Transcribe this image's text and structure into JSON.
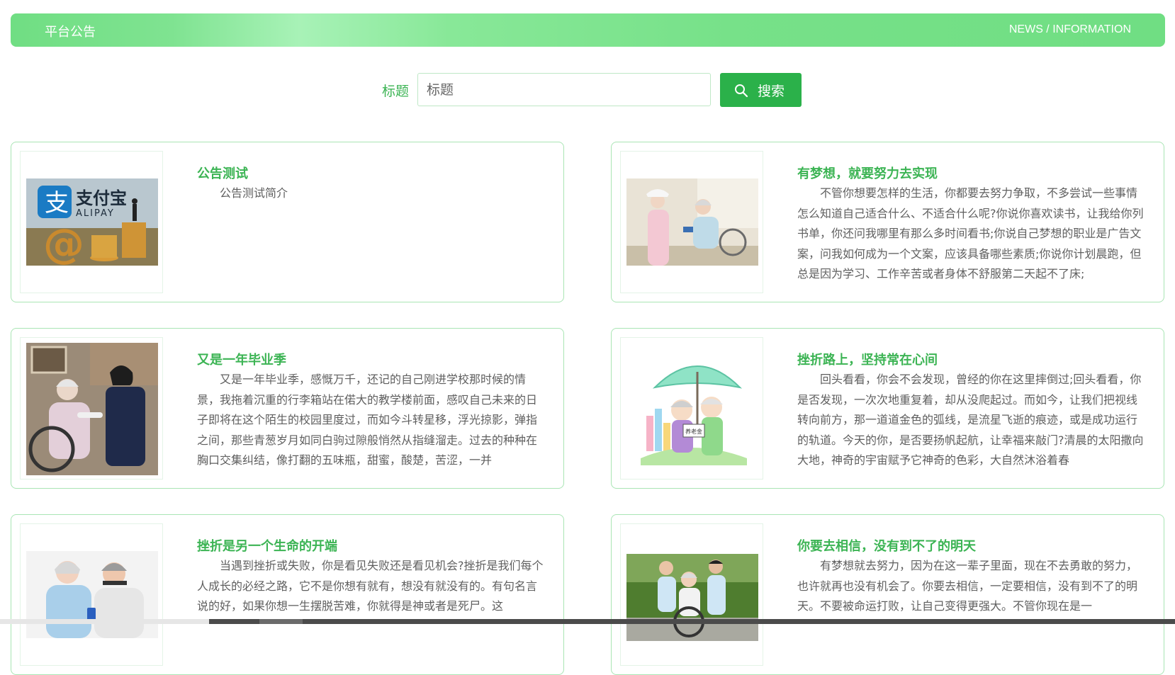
{
  "header": {
    "title": "平台公告",
    "subtitle": "NEWS / INFORMATION"
  },
  "search": {
    "label": "标题",
    "placeholder": "标题",
    "button_label": "搜索"
  },
  "colors": {
    "accent": "#2bb14a",
    "title_green": "#3cb454",
    "border_green": "#a9e5b4"
  },
  "cards": [
    {
      "title": "公告测试",
      "summary": "公告测试简介",
      "image": "alipay-logo-with-coins"
    },
    {
      "title": "有梦想，就要努力去实现",
      "summary": "不管你想要怎样的生活，你都要去努力争取，不多尝试一些事情怎么知道自己适合什么、不适合什么呢?你说你喜欢读书，让我给你列书单，你还问我哪里有那么多时间看书;你说自己梦想的职业是广告文案，问我如何成为一个文案，应该具备哪些素质;你说你计划晨跑，但总是因为学习、工作辛苦或者身体不舒服第二天起不了床;",
      "image": "nurse-with-elderly-woman"
    },
    {
      "title": "又是一年毕业季",
      "summary": "又是一年毕业季，感慨万千，还记的自己刚进学校那时候的情景，我拖着沉重的行李箱站在偌大的教学楼前面，感叹自己未来的日子即将在这个陌生的校园里度过，而如今斗转星移，浮光掠影，弹指之间，那些青葱岁月如同白驹过隙般悄然从指缝溜走。过去的种种在胸口交集纠结，像打翻的五味瓶，甜蜜，酸楚，苦涩，一并",
      "image": "caregiver-feeding-elderly-woman"
    },
    {
      "title": "挫折路上，坚持常在心间",
      "summary": "回头看看，你会不会发现，曾经的你在这里摔倒过;回头看看，你是否发现，一次次地重复着，却从没爬起过。而如今，让我们把视线转向前方，那一道道金色的弧线，是流星飞逝的痕迹，或是成功运行的轨道。今天的你，是否要扬帆起航，让幸福来敲门?清晨的太阳撒向大地，神奇的宇宙赋予它神奇的色彩，大自然沐浴着春",
      "image": "elderly-couple-under-umbrella",
      "sign_text": "养老金"
    },
    {
      "title": "挫折是另一个生命的开端",
      "summary": "当遇到挫折或失败，你是看见失败还是看见机会?挫折是我们每个人成长的必经之路，它不是你想有就有，想没有就没有的。有句名言说的好，如果你想一生摆脱苦难，你就得是神或者是死尸。这",
      "image": "smiling-elderly-couple"
    },
    {
      "title": "你要去相信，没有到不了的明天",
      "summary": "有梦想就去努力，因为在这一辈子里面，现在不去勇敢的努力，也许就再也没有机会了。你要去相信，一定要相信，没有到不了的明天。不要被命运打败，让自己变得更强大。不管你现在是一",
      "image": "caregivers-with-wheelchair-in-park"
    }
  ]
}
